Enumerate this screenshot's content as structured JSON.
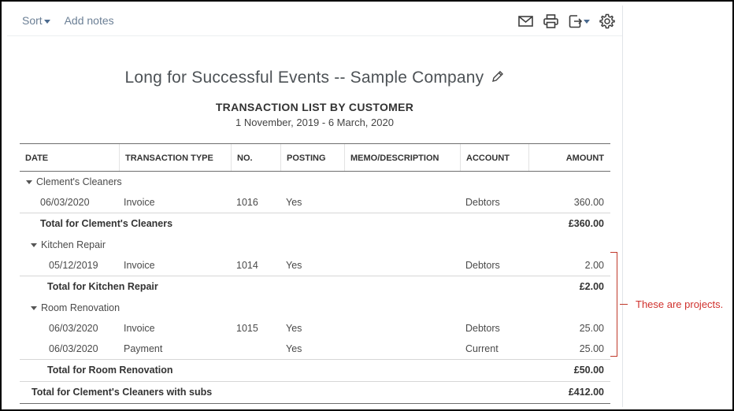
{
  "toolbar": {
    "sort_label": "Sort",
    "add_notes_label": "Add notes",
    "icons": [
      "email-icon",
      "print-icon",
      "export-icon",
      "settings-icon"
    ]
  },
  "report": {
    "company": "Long for Successful Events -- Sample Company",
    "title": "TRANSACTION LIST BY CUSTOMER",
    "dates": "1 November, 2019 - 6 March, 2020"
  },
  "columns": {
    "date": "DATE",
    "type": "TRANSACTION TYPE",
    "no": "NO.",
    "posting": "POSTING",
    "memo": "MEMO/DESCRIPTION",
    "account": "ACCOUNT",
    "amount": "AMOUNT"
  },
  "groups": {
    "customer": {
      "name": "Clement's Cleaners"
    },
    "customer_tx": [
      {
        "date": "06/03/2020",
        "type": "Invoice",
        "no": "1016",
        "posting": "Yes",
        "memo": "",
        "account": "Debtors",
        "amount": "360.00"
      }
    ],
    "customer_total": {
      "label": "Total for Clement's Cleaners",
      "amount": "£360.00"
    },
    "kitchen": {
      "name": "Kitchen Repair"
    },
    "kitchen_tx": [
      {
        "date": "05/12/2019",
        "type": "Invoice",
        "no": "1014",
        "posting": "Yes",
        "memo": "",
        "account": "Debtors",
        "amount": "2.00"
      }
    ],
    "kitchen_total": {
      "label": "Total for Kitchen Repair",
      "amount": "£2.00"
    },
    "room": {
      "name": "Room Renovation"
    },
    "room_tx": [
      {
        "date": "06/03/2020",
        "type": "Invoice",
        "no": "1015",
        "posting": "Yes",
        "memo": "",
        "account": "Debtors",
        "amount": "25.00"
      },
      {
        "date": "06/03/2020",
        "type": "Payment",
        "no": "",
        "posting": "Yes",
        "memo": "",
        "account": "Current",
        "amount": "25.00"
      }
    ],
    "room_total": {
      "label": "Total for Room Renovation",
      "amount": "£50.00"
    },
    "grand_total": {
      "label": "Total for Clement's Cleaners with subs",
      "amount": "£412.00"
    }
  },
  "annotation": {
    "text": "These are projects.",
    "color": "#d0312d"
  }
}
